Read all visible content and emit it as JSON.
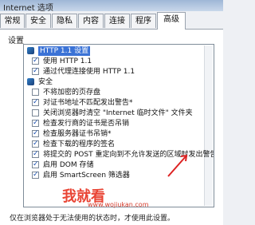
{
  "window": {
    "title": "Internet 选项"
  },
  "tabs": [
    "常规",
    "安全",
    "隐私",
    "内容",
    "连接",
    "程序",
    "高级"
  ],
  "settings": {
    "label": "设置",
    "items": [
      {
        "text": "HTTP 1.1 设置",
        "type": "group",
        "highlight": true
      },
      {
        "text": "使用 HTTP 1.1",
        "type": "check",
        "checked": true
      },
      {
        "text": "通过代理连接使用 HTTP 1.1",
        "type": "check",
        "checked": true
      },
      {
        "text": "安全",
        "type": "group"
      },
      {
        "text": "不将加密的页存盘",
        "type": "check",
        "checked": false
      },
      {
        "text": "对证书地址不匹配发出警告*",
        "type": "check",
        "checked": true
      },
      {
        "text": "关闭浏览器时清空 \"Internet 临时文件\" 文件夹",
        "type": "check",
        "checked": false
      },
      {
        "text": "检查发行商的证书是否吊销",
        "type": "check",
        "checked": true
      },
      {
        "text": "检查服务器证书吊销*",
        "type": "check",
        "checked": true
      },
      {
        "text": "检查下载的程序的签名",
        "type": "check",
        "checked": true
      },
      {
        "text": "将提交的 POST 重定向到不允许发送的区域时发出警告",
        "type": "check",
        "checked": true
      },
      {
        "text": "启用 DOM 存储",
        "type": "check",
        "checked": true
      },
      {
        "text": "启用 SmartScreen 筛选器",
        "type": "check",
        "checked": true
      }
    ]
  },
  "watermark": {
    "main": "我就看",
    "sub": "www.wojiukan.com"
  },
  "footer": {
    "note": "仅在浏览器处于无法使用的状态时，才使用此设置。"
  }
}
